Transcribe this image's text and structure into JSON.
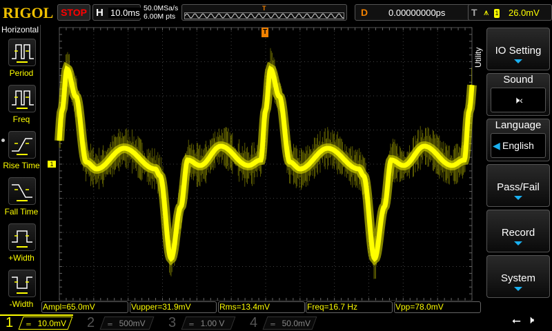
{
  "header": {
    "logo": "RIGOL",
    "run_state": "STOP",
    "timebase_key": "H",
    "timebase": "10.0ms",
    "sample_rate": "50.0MSa/s",
    "memory_depth": "6.00M pts",
    "delay_key": "D",
    "delay": "0.00000000ps",
    "trigger_key": "T",
    "trigger_edge": "rising",
    "trigger_source": "1",
    "trigger_level": "26.0mV"
  },
  "left_menu": {
    "title": "Horizontal",
    "items": [
      {
        "label": "Period"
      },
      {
        "label": "Freq"
      },
      {
        "label": "Rise Time"
      },
      {
        "label": "Fall Time"
      },
      {
        "label": "+Width"
      },
      {
        "label": "-Width"
      }
    ]
  },
  "right_menu": {
    "title": "Utility",
    "items": [
      {
        "label": "IO Setting"
      },
      {
        "label": "Sound",
        "value": "speaker-muted-icon"
      },
      {
        "label": "Language",
        "value": "English"
      },
      {
        "label": "Pass/Fail"
      },
      {
        "label": "Record"
      },
      {
        "label": "System"
      }
    ]
  },
  "measurements": [
    "Ampl=65.0mV",
    "Vupper=31.9mV",
    "Rms=13.4mV",
    "Freq=16.7 Hz",
    "Vpp=78.0mV"
  ],
  "channels": [
    {
      "num": "1",
      "scale": "10.0mV",
      "color": "#ffff00",
      "active": true
    },
    {
      "num": "2",
      "scale": "500mV",
      "color": "#00c0c0",
      "active": false
    },
    {
      "num": "3",
      "scale": "1.00 V",
      "color": "#c000c0",
      "active": false
    },
    {
      "num": "4",
      "scale": "50.0mV",
      "color": "#2080ff",
      "active": false
    }
  ],
  "channel_marker": "1",
  "trigger_marker": "T",
  "status_icons": [
    "usb-icon",
    "speaker-muted-icon"
  ],
  "colors": {
    "trace": "#ffff00",
    "trigger": "#f08000",
    "menu_arrow": "#1ab0f0"
  }
}
